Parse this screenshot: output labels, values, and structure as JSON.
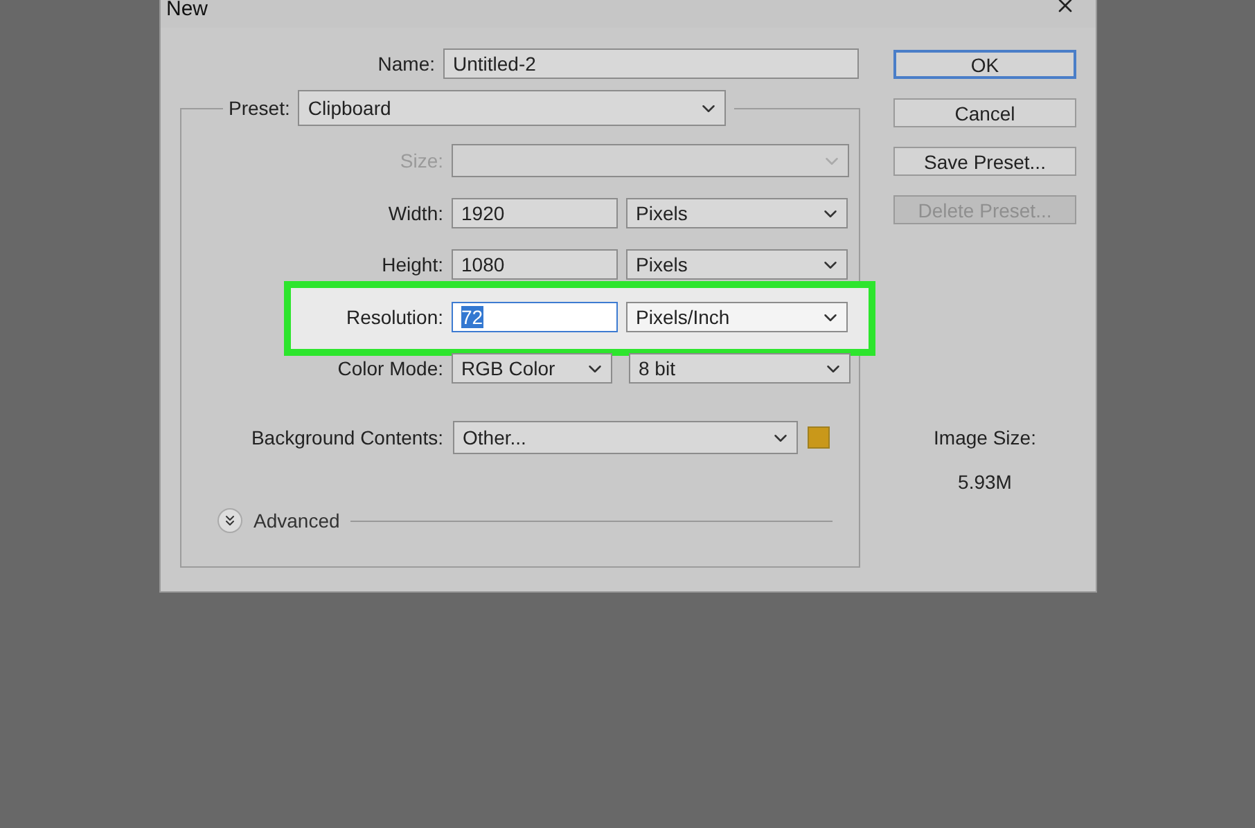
{
  "window": {
    "title": "New"
  },
  "name": {
    "label": "Name:",
    "value": "Untitled-2"
  },
  "preset": {
    "label": "Preset:",
    "value": "Clipboard"
  },
  "size": {
    "label": "Size:",
    "disabled": true
  },
  "rows": [
    {
      "label": "Width:",
      "value": "1920",
      "unit": "Pixels",
      "highlighted": false,
      "text_selected": false
    },
    {
      "label": "Height:",
      "value": "1080",
      "unit": "Pixels",
      "highlighted": false,
      "text_selected": false
    },
    {
      "label": "Resolution:",
      "value": "72",
      "unit": "Pixels/Inch",
      "highlighted": true,
      "text_selected": true
    }
  ],
  "color_mode": {
    "label": "Color Mode:",
    "value": "RGB Color",
    "depth": "8 bit"
  },
  "background": {
    "label": "Background Contents:",
    "value": "Other...",
    "color": "#c9981a"
  },
  "advanced": {
    "label": "Advanced",
    "expanded": false
  },
  "buttons": [
    {
      "label": "OK",
      "default": true,
      "disabled": false
    },
    {
      "label": "Cancel",
      "default": false,
      "disabled": false
    },
    {
      "label": "Save Preset...",
      "default": false,
      "disabled": false
    },
    {
      "label": "Delete Preset...",
      "default": false,
      "disabled": true
    }
  ],
  "image_size": {
    "label": "Image Size:",
    "value": "5.93M"
  }
}
